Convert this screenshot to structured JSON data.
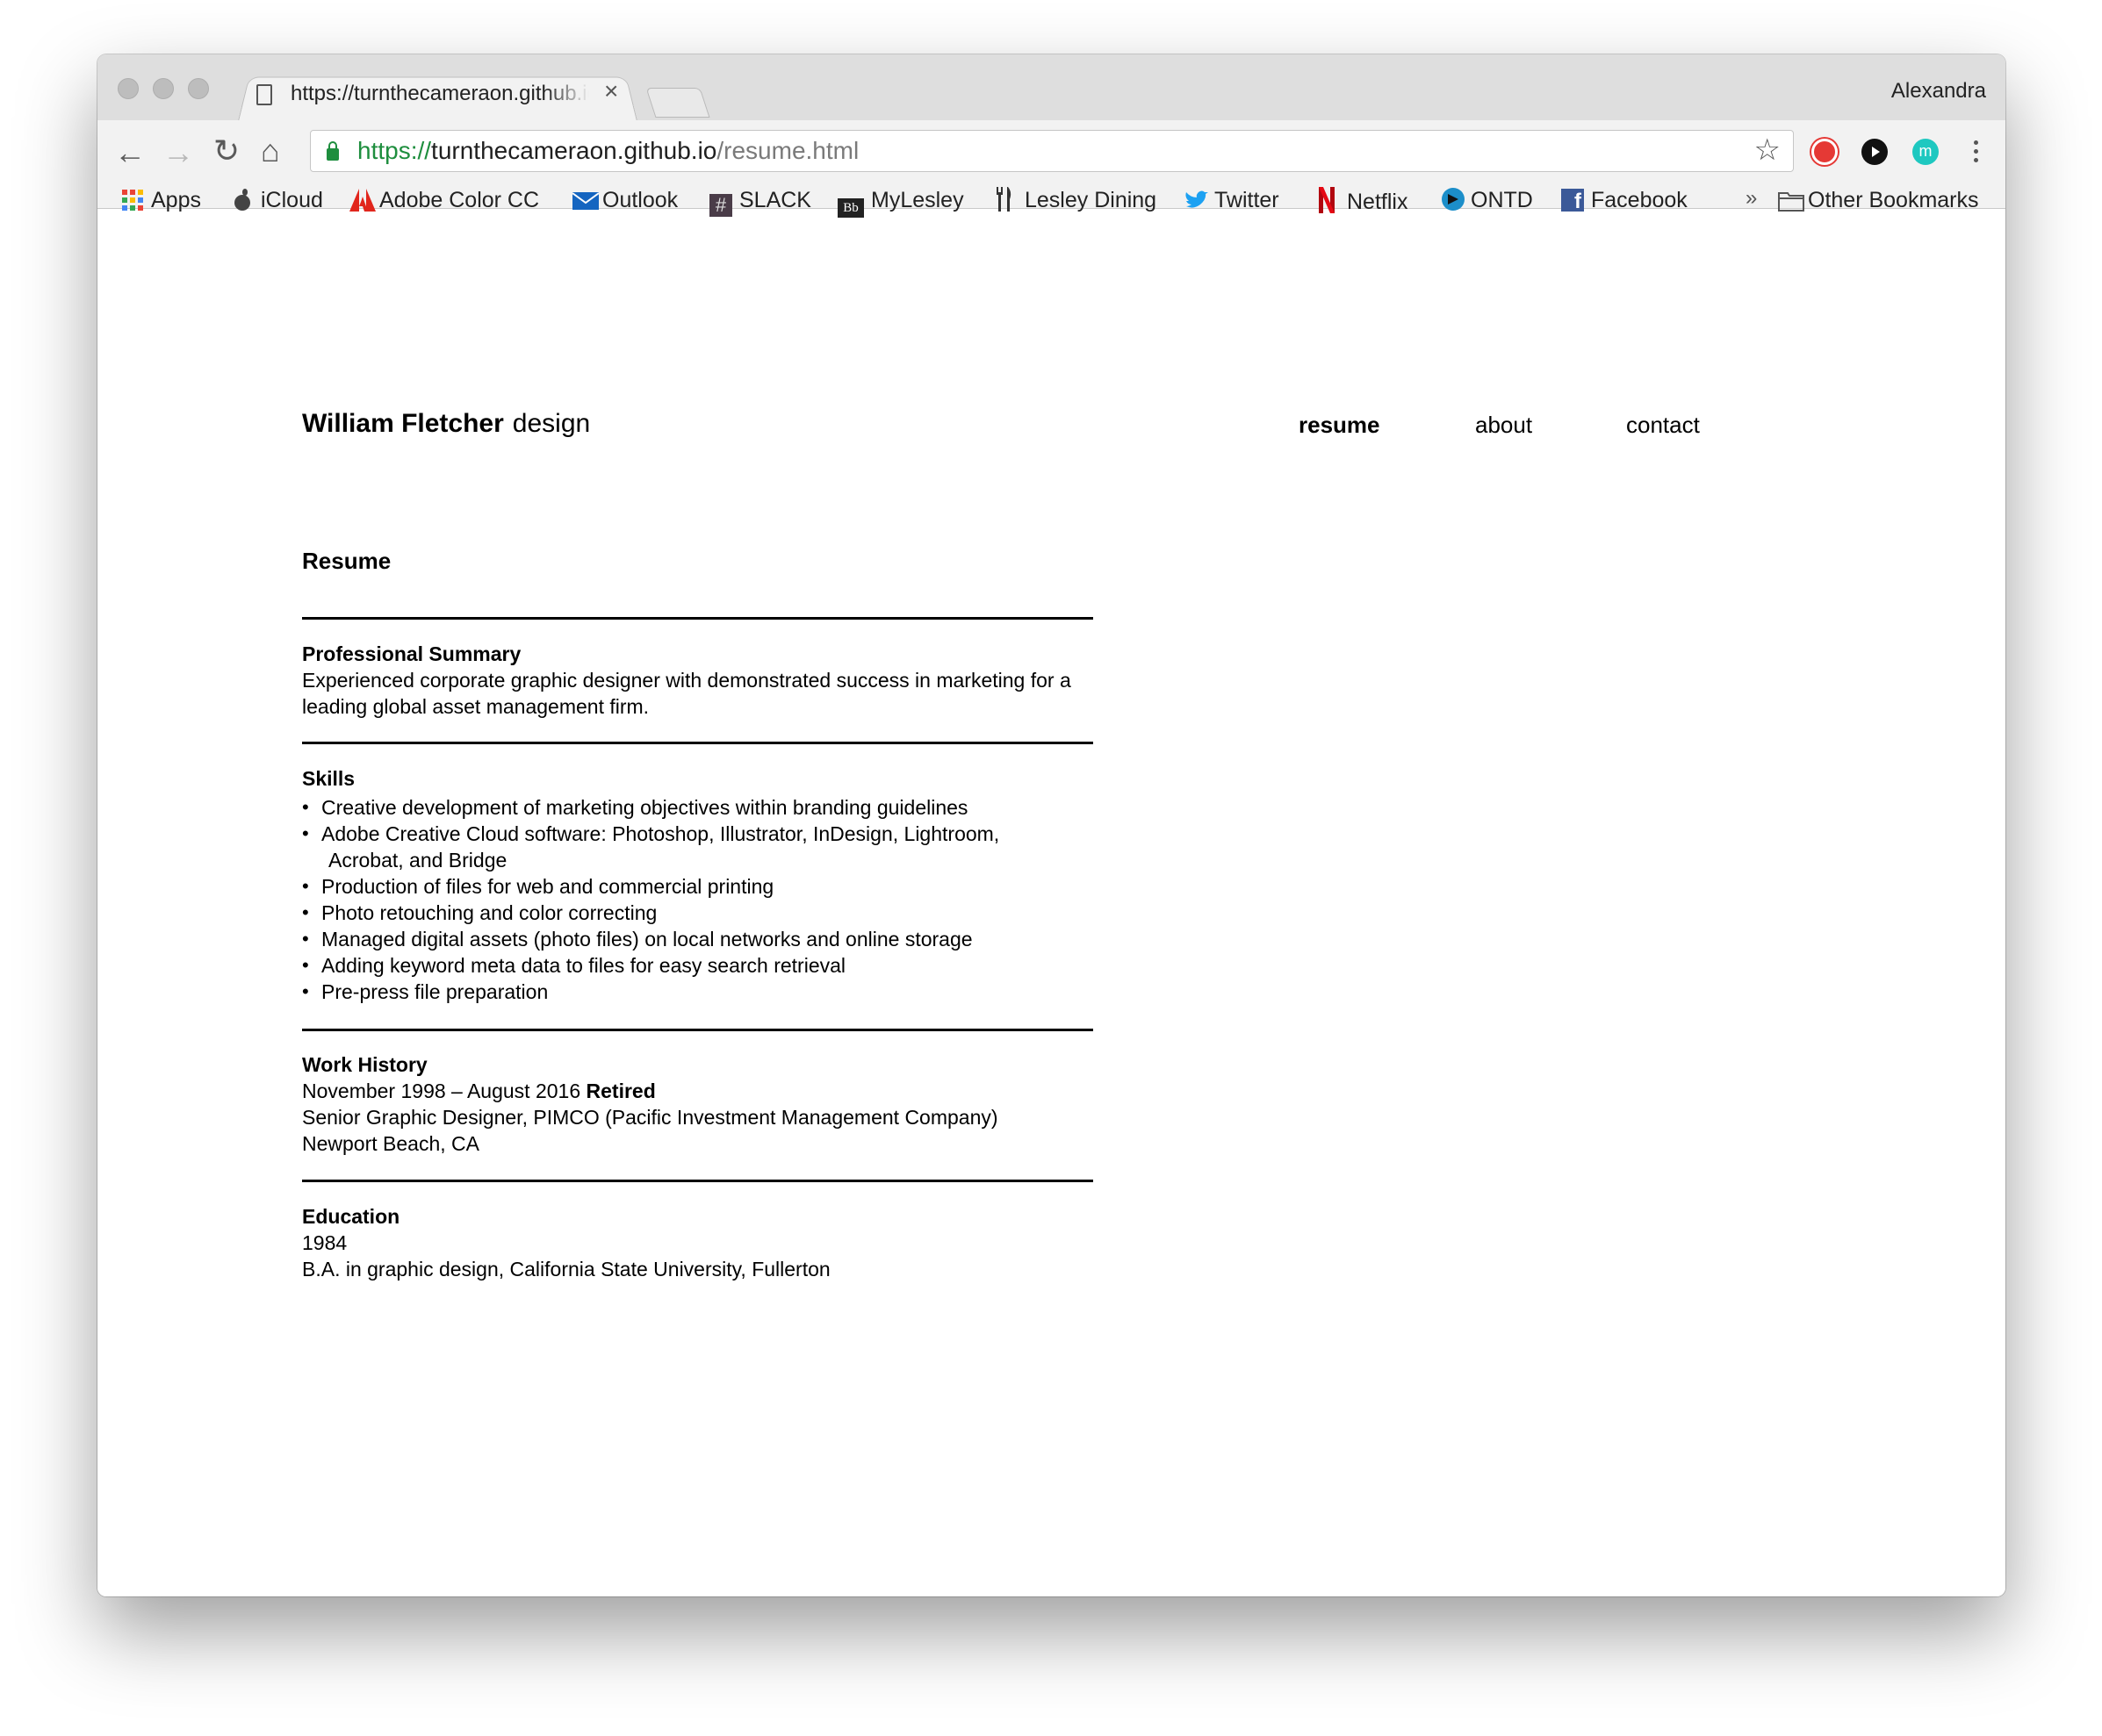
{
  "browser": {
    "tab_title": "https://turnthecameraon.github.io/resume.html",
    "tab_close": "×",
    "profile_name": "Alexandra",
    "url": {
      "scheme": "https://",
      "host": "turnthecameraon.github.io",
      "path": "/resume.html"
    },
    "nav": {
      "back": "←",
      "forward": "→",
      "reload": "↻",
      "home": "⌂"
    },
    "star": "☆",
    "overflow": "»",
    "bookmarks": [
      {
        "label": "Apps",
        "icon": "apps-grid-icon"
      },
      {
        "label": "iCloud",
        "icon": "apple-icon"
      },
      {
        "label": "Adobe Color CC",
        "icon": "adobe-icon"
      },
      {
        "label": "Outlook",
        "icon": "mail-icon"
      },
      {
        "label": "SLACK",
        "icon": "hash-icon"
      },
      {
        "label": "MyLesley",
        "icon": "bb-icon"
      },
      {
        "label": "Lesley Dining",
        "icon": "cutlery-icon"
      },
      {
        "label": "Twitter",
        "icon": "twitter-icon"
      },
      {
        "label": "Netflix",
        "icon": "netflix-icon"
      },
      {
        "label": "ONTD",
        "icon": "ontd-icon"
      },
      {
        "label": "Facebook",
        "icon": "facebook-icon"
      }
    ],
    "other_bookmarks": "Other Bookmarks",
    "colors": {
      "secure_green": "#1e8e3e",
      "chrome_gray": "#dedede"
    }
  },
  "site": {
    "brand_name": "William Fletcher",
    "brand_suffix": "design",
    "nav": [
      {
        "label": "resume",
        "active": true
      },
      {
        "label": "about",
        "active": false
      },
      {
        "label": "contact",
        "active": false
      }
    ]
  },
  "resume": {
    "title": "Resume",
    "summary": {
      "heading": "Professional Summary",
      "text": "Experienced corporate graphic designer with demonstrated success in marketing for a leading global asset management firm."
    },
    "skills": {
      "heading": "Skills",
      "items": [
        "Creative development of marketing objectives within branding guidelines",
        "Adobe Creative Cloud software: Photoshop, Illustrator, InDesign, Lightroom,",
        "Production of files for web and commercial printing",
        "Photo retouching and color correcting",
        "Managed digital assets (photo files) on local networks and online storage",
        "Adding keyword meta data to files for easy search retrieval",
        "Pre-press file preparation"
      ],
      "item2_wrap": "Acrobat, and Bridge"
    },
    "work": {
      "heading": "Work History",
      "dates": "November 1998 – August 2016",
      "status": "Retired",
      "role": "Senior Graphic Designer, PIMCO (Pacific Investment Management Company)",
      "location": "Newport Beach, CA"
    },
    "education": {
      "heading": "Education",
      "year": "1984",
      "degree": "B.A. in graphic design, California State University, Fullerton"
    }
  }
}
